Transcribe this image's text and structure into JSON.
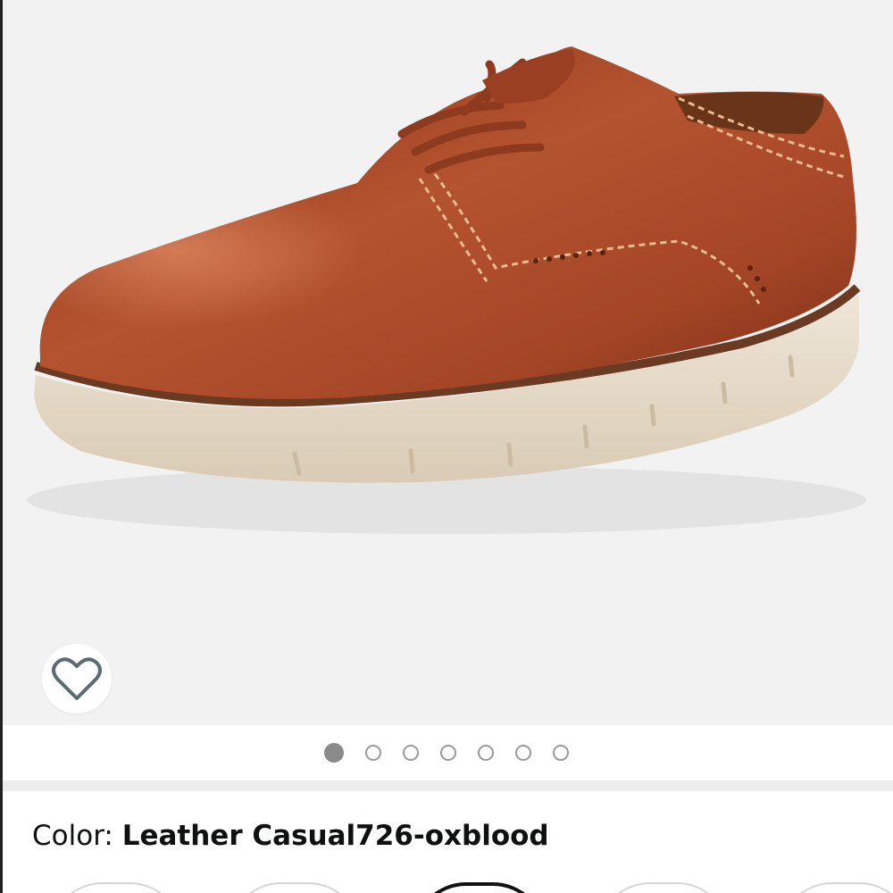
{
  "product_gallery": {
    "image_alt": "Leather Casual726-oxblood derby shoe",
    "image_count": 7,
    "active_index": 0
  },
  "wishlist": {
    "icon": "heart-outline-icon"
  },
  "variant": {
    "label": "Color:",
    "value": "Leather Casual726-oxblood"
  },
  "swatches": {
    "count": 5,
    "selected_index": 2
  },
  "colors": {
    "background": "#f2f2f2",
    "leather": "#a8472a",
    "sole": "#e8ddcc",
    "text": "#0f1111"
  }
}
